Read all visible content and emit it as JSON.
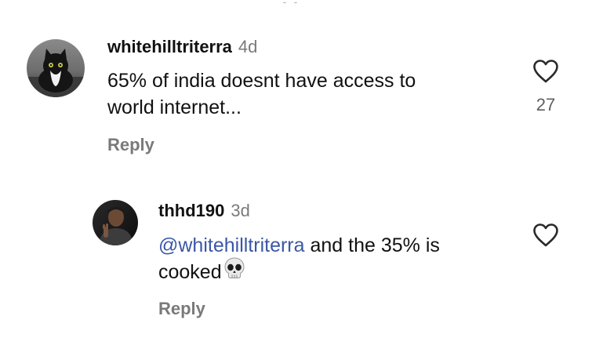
{
  "comments": [
    {
      "username": "whitehilltriterra",
      "time": "4d",
      "text_line1": "65% of india doesnt have access to",
      "text_line2": "world internet...",
      "reply_label": "Reply",
      "like_count": "27",
      "avatar_icon": "cat-avatar"
    },
    {
      "username": "thhd190",
      "time": "3d",
      "mention": "@whitehilltriterra",
      "text_after_mention": " and the 35% is",
      "text_line2": "cooked",
      "emoji": "skull-emoji",
      "reply_label": "Reply",
      "like_count": "",
      "avatar_icon": "person-avatar"
    }
  ],
  "colors": {
    "text": "#111111",
    "muted": "#7a7a7a",
    "mention": "#3b57a6"
  }
}
